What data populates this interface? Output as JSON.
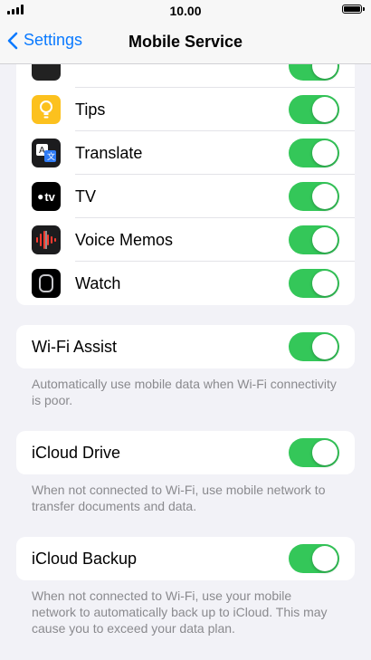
{
  "status_bar": {
    "time": "10.00"
  },
  "nav": {
    "back_label": "Settings",
    "title": "Mobile Service"
  },
  "apps": [
    {
      "label": "Tips",
      "icon": "tips-icon"
    },
    {
      "label": "Translate",
      "icon": "translate-icon"
    },
    {
      "label": "TV",
      "icon": "tv-icon"
    },
    {
      "label": "Voice Memos",
      "icon": "voice-memos-icon"
    },
    {
      "label": "Watch",
      "icon": "watch-icon"
    }
  ],
  "wifi_assist": {
    "label": "Wi-Fi Assist",
    "footnote": "Automatically use mobile data when Wi-Fi connectivity is poor."
  },
  "icloud_drive": {
    "label": "iCloud Drive",
    "footnote": "When not connected to Wi-Fi, use mobile network to transfer documents and data."
  },
  "icloud_backup": {
    "label": "iCloud Backup",
    "footnote": "When not connected to Wi-Fi, use your mobile network to automatically back up to iCloud. This may cause you to exceed your data plan."
  },
  "tv_icon_text": "tv",
  "colors": {
    "accent": "#0a7aff",
    "toggle_on": "#34c759",
    "background": "#f2f2f7"
  }
}
